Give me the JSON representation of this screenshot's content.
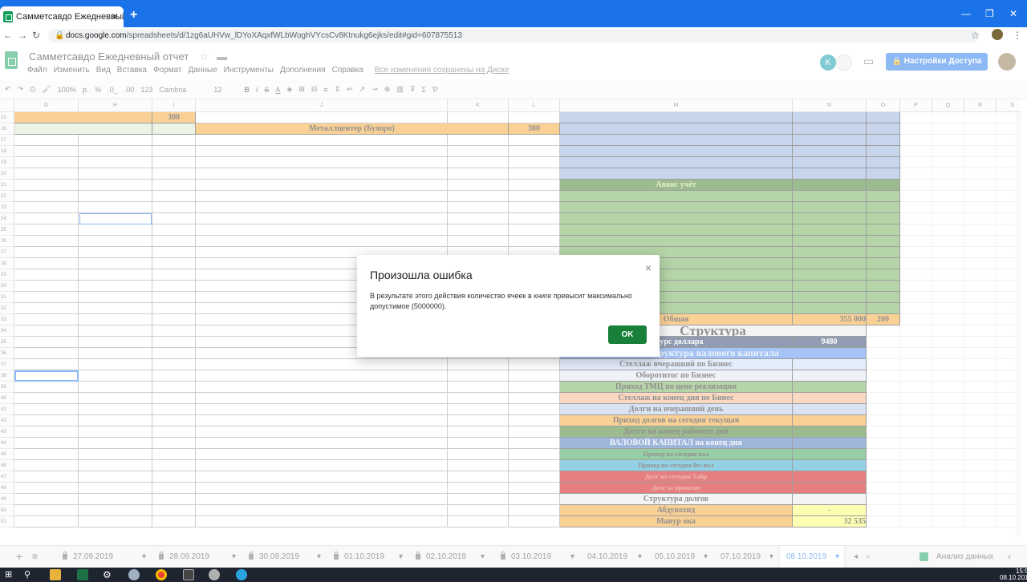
{
  "browser": {
    "tab_title": "Самметсавдо Ежедневный от",
    "url_prefix": "docs.google.com",
    "url_path": "/spreadsheets/d/1zg6aUHVw_lDYoXAqxfWLbWoghVYcsCv8Ktnukg6ejks/edit#gid=607875513"
  },
  "doc": {
    "title": "Самметсавдо Ежедневный отчет",
    "menu": [
      "Файл",
      "Изменить",
      "Вид",
      "Вставка",
      "Формат",
      "Данные",
      "Инструменты",
      "Дополнения",
      "Справка"
    ],
    "saved_status": "Все изменения сохранены на Диске",
    "share_label": "Настройки Доступа",
    "avatar_letter": "K"
  },
  "toolbar": {
    "zoom": "100%",
    "currency": "р.",
    "percent": "%",
    "dec1": ".0_",
    "dec2": ".00",
    "fmt": "123",
    "font": "Cambria",
    "size": "12"
  },
  "columns": [
    "G",
    "H",
    "I",
    "J",
    "K",
    "L",
    "M",
    "N",
    "O",
    "P",
    "Q",
    "R",
    "S"
  ],
  "rows": [
    "15",
    "16",
    "17",
    "18",
    "19",
    "20",
    "21",
    "22",
    "23",
    "24",
    "25",
    "26",
    "27",
    "28",
    "29",
    "30",
    "31",
    "32",
    "33",
    "34",
    "35",
    "36",
    "37",
    "38",
    "39",
    "40",
    "41",
    "42",
    "43",
    "44",
    "45",
    "46",
    "47",
    "48",
    "49",
    "50",
    "51"
  ],
  "cells": {
    "i15": "300",
    "j16": "Металлцентер (Бухоро)",
    "l16": "300",
    "m21": "Авянс учёт",
    "m33": "Общая",
    "n33": "355 000",
    "o33": "200",
    "m34": "Структура",
    "m35": "й курс доллара",
    "n35": "9480",
    "m36": "Структура  валового капитала",
    "m37": "Стеллаж  вчерашний по  Бизнес",
    "m38": "Оборотитог по Бизнес",
    "m39": "Приход ТМЦ по цене реализации",
    "m40": "Стеллаж на конец  дня по  Бинес",
    "m41": "Долги на вчерашний день",
    "m42": "Приход долгов на сегодня  текущая",
    "m43": "Долги на конец рабочего дня",
    "m44": "ВАЛОВОЙ КАПИТАЛ  на конец дня",
    "m45": "Приход на сегодня нал",
    "m46": "Приход на сегодня без нал",
    "m47": "Долг на сегодня  Тайр",
    "m48": "Долг за прошлое",
    "m49": "Структура долгов",
    "m50": "Абдувохид",
    "n50": "-",
    "m51": "Манур ока",
    "n51": "32 535"
  },
  "sheet_tabs": {
    "t1": "27.09.2019",
    "t2": "28.09.2019",
    "t3": "30.09.2019",
    "t4": "01.10.2019",
    "t5": "02.10.2019",
    "t6": "03.10.2019",
    "t7": "04.10.2019",
    "t8": "05.10.2019",
    "t9": "07.10.2019",
    "t10": "08.10.2019",
    "explore": "Анализ данных"
  },
  "taskbar": {
    "time": "15:55",
    "date": "08.10.2019"
  },
  "dialog": {
    "title": "Произошла ошибка",
    "message": "В результате этого действия количество ячеек в книге превысит максимально допустимое (5000000).",
    "ok_label": "OK",
    "close_glyph": "×"
  },
  "colors": {
    "orange": "#f4a32a",
    "blue": "#8eaadb",
    "green": "#6aa84f",
    "dark_green": "#38761d",
    "red": "#cc0000",
    "navy": "#1f3864",
    "accent": "#1a73e8"
  }
}
